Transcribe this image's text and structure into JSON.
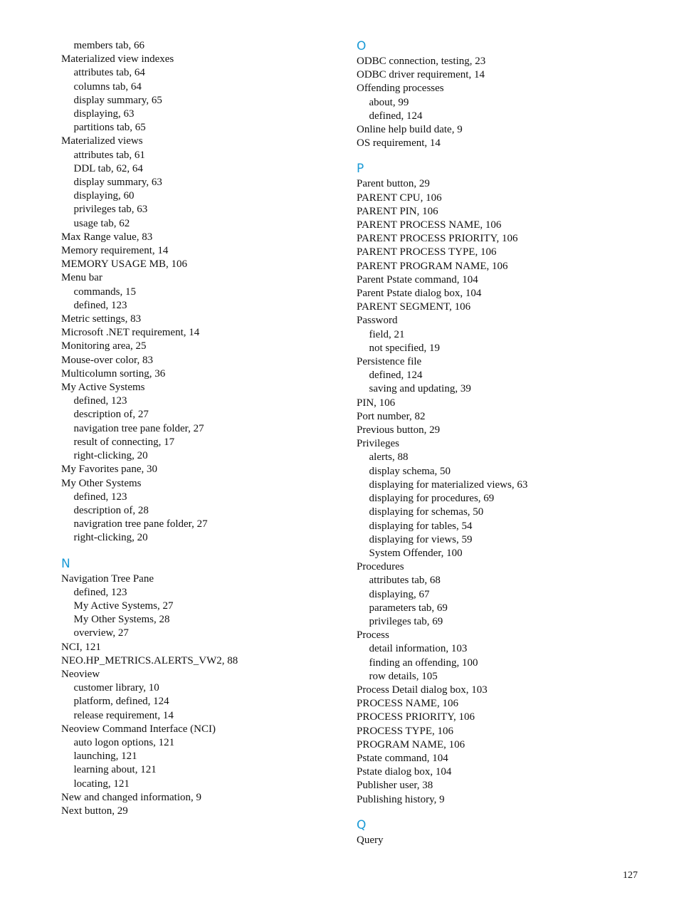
{
  "accent_color": "#1a9ad6",
  "page_number": "127",
  "columns": [
    {
      "groups": [
        {
          "letter": "",
          "entries": [
            {
              "text": "members tab, 66",
              "level": 1
            },
            {
              "text": "Materialized view indexes",
              "level": 0
            },
            {
              "text": "attributes tab, 64",
              "level": 1
            },
            {
              "text": "columns tab, 64",
              "level": 1
            },
            {
              "text": "display summary, 65",
              "level": 1
            },
            {
              "text": "displaying, 63",
              "level": 1
            },
            {
              "text": "partitions tab, 65",
              "level": 1
            },
            {
              "text": "Materialized views",
              "level": 0
            },
            {
              "text": "attributes tab, 61",
              "level": 1
            },
            {
              "text": "DDL tab, 62, 64",
              "level": 1
            },
            {
              "text": "display summary, 63",
              "level": 1
            },
            {
              "text": "displaying, 60",
              "level": 1
            },
            {
              "text": "privileges tab, 63",
              "level": 1
            },
            {
              "text": "usage tab, 62",
              "level": 1
            },
            {
              "text": "Max Range value, 83",
              "level": 0
            },
            {
              "text": "Memory requirement, 14",
              "level": 0
            },
            {
              "text": "MEMORY USAGE MB, 106",
              "level": 0
            },
            {
              "text": "Menu bar",
              "level": 0
            },
            {
              "text": "commands, 15",
              "level": 1
            },
            {
              "text": "defined, 123",
              "level": 1
            },
            {
              "text": "Metric settings, 83",
              "level": 0
            },
            {
              "text": "Microsoft .NET requirement, 14",
              "level": 0
            },
            {
              "text": "Monitoring area, 25",
              "level": 0
            },
            {
              "text": "Mouse-over color, 83",
              "level": 0
            },
            {
              "text": "Multicolumn sorting, 36",
              "level": 0
            },
            {
              "text": "My Active Systems",
              "level": 0
            },
            {
              "text": "defined, 123",
              "level": 1
            },
            {
              "text": "description of, 27",
              "level": 1
            },
            {
              "text": "navigation tree pane folder, 27",
              "level": 1
            },
            {
              "text": "result of connecting, 17",
              "level": 1
            },
            {
              "text": "right-clicking, 20",
              "level": 1
            },
            {
              "text": "My Favorites pane, 30",
              "level": 0
            },
            {
              "text": "My Other Systems",
              "level": 0
            },
            {
              "text": "defined, 123",
              "level": 1
            },
            {
              "text": "description of, 28",
              "level": 1
            },
            {
              "text": "navigration tree pane folder, 27",
              "level": 1
            },
            {
              "text": "right-clicking, 20",
              "level": 1
            }
          ]
        },
        {
          "letter": "N",
          "entries": [
            {
              "text": "Navigation Tree Pane",
              "level": 0
            },
            {
              "text": "defined, 123",
              "level": 1
            },
            {
              "text": "My Active Systems, 27",
              "level": 1
            },
            {
              "text": "My Other Systems, 28",
              "level": 1
            },
            {
              "text": "overview, 27",
              "level": 1
            },
            {
              "text": "NCI, 121",
              "level": 0
            },
            {
              "text": "NEO.HP_METRICS.ALERTS_VW2, 88",
              "level": 0
            },
            {
              "text": "Neoview",
              "level": 0
            },
            {
              "text": "customer library, 10",
              "level": 1
            },
            {
              "text": "platform, defined, 124",
              "level": 1
            },
            {
              "text": "release requirement, 14",
              "level": 1
            },
            {
              "text": "Neoview Command Interface (NCI)",
              "level": 0
            },
            {
              "text": "auto logon options, 121",
              "level": 1
            },
            {
              "text": "launching, 121",
              "level": 1
            },
            {
              "text": "learning about, 121",
              "level": 1
            },
            {
              "text": "locating, 121",
              "level": 1
            },
            {
              "text": "New and changed information, 9",
              "level": 0
            },
            {
              "text": "Next button, 29",
              "level": 0
            }
          ]
        }
      ]
    },
    {
      "groups": [
        {
          "letter": "O",
          "entries": [
            {
              "text": "ODBC connection, testing, 23",
              "level": 0
            },
            {
              "text": "ODBC driver requirement, 14",
              "level": 0
            },
            {
              "text": "Offending processes",
              "level": 0
            },
            {
              "text": "about, 99",
              "level": 1
            },
            {
              "text": "defined, 124",
              "level": 1
            },
            {
              "text": "Online help build date, 9",
              "level": 0
            },
            {
              "text": "OS requirement, 14",
              "level": 0
            }
          ]
        },
        {
          "letter": "P",
          "entries": [
            {
              "text": "Parent button, 29",
              "level": 0
            },
            {
              "text": "PARENT CPU, 106",
              "level": 0
            },
            {
              "text": "PARENT PIN, 106",
              "level": 0
            },
            {
              "text": "PARENT PROCESS NAME, 106",
              "level": 0
            },
            {
              "text": "PARENT PROCESS PRIORITY, 106",
              "level": 0
            },
            {
              "text": "PARENT PROCESS TYPE, 106",
              "level": 0
            },
            {
              "text": "PARENT PROGRAM NAME, 106",
              "level": 0
            },
            {
              "text": "Parent Pstate command, 104",
              "level": 0
            },
            {
              "text": "Parent Pstate dialog box, 104",
              "level": 0
            },
            {
              "text": "PARENT SEGMENT, 106",
              "level": 0
            },
            {
              "text": "Password",
              "level": 0
            },
            {
              "text": "field, 21",
              "level": 1
            },
            {
              "text": "not specified, 19",
              "level": 1
            },
            {
              "text": "Persistence file",
              "level": 0
            },
            {
              "text": "defined, 124",
              "level": 1
            },
            {
              "text": "saving and updating, 39",
              "level": 1
            },
            {
              "text": "PIN, 106",
              "level": 0
            },
            {
              "text": "Port number, 82",
              "level": 0
            },
            {
              "text": "Previous button, 29",
              "level": 0
            },
            {
              "text": "Privileges",
              "level": 0
            },
            {
              "text": "alerts, 88",
              "level": 1
            },
            {
              "text": "display schema, 50",
              "level": 1
            },
            {
              "text": "displaying for materialized views, 63",
              "level": 1
            },
            {
              "text": "displaying for procedures, 69",
              "level": 1
            },
            {
              "text": "displaying for schemas, 50",
              "level": 1
            },
            {
              "text": "displaying for tables, 54",
              "level": 1
            },
            {
              "text": "displaying for views, 59",
              "level": 1
            },
            {
              "text": "System Offender, 100",
              "level": 1
            },
            {
              "text": "Procedures",
              "level": 0
            },
            {
              "text": "attributes tab, 68",
              "level": 1
            },
            {
              "text": "displaying, 67",
              "level": 1
            },
            {
              "text": "parameters tab, 69",
              "level": 1
            },
            {
              "text": "privileges tab, 69",
              "level": 1
            },
            {
              "text": "Process",
              "level": 0
            },
            {
              "text": "detail information, 103",
              "level": 1
            },
            {
              "text": "finding an offending, 100",
              "level": 1
            },
            {
              "text": "row details, 105",
              "level": 1
            },
            {
              "text": "Process Detail dialog box, 103",
              "level": 0
            },
            {
              "text": "PROCESS NAME, 106",
              "level": 0
            },
            {
              "text": "PROCESS PRIORITY, 106",
              "level": 0
            },
            {
              "text": "PROCESS TYPE, 106",
              "level": 0
            },
            {
              "text": "PROGRAM NAME, 106",
              "level": 0
            },
            {
              "text": "Pstate command, 104",
              "level": 0
            },
            {
              "text": "Pstate dialog box, 104",
              "level": 0
            },
            {
              "text": "Publisher user, 38",
              "level": 0
            },
            {
              "text": "Publishing history, 9",
              "level": 0
            }
          ]
        },
        {
          "letter": "Q",
          "entries": [
            {
              "text": "Query",
              "level": 0
            }
          ]
        }
      ]
    }
  ]
}
